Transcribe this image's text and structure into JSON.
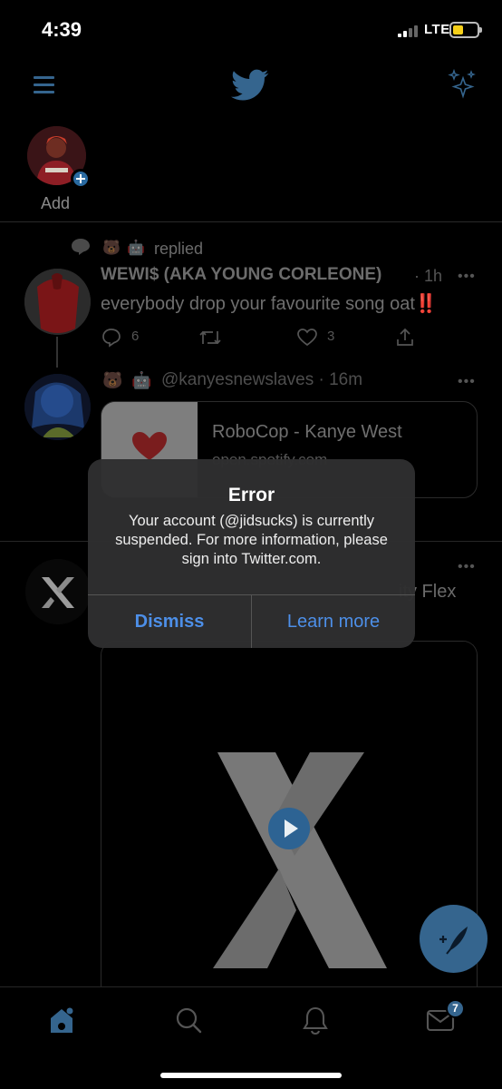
{
  "status_bar": {
    "time": "4:39",
    "network": "LTE",
    "colors": {
      "battery": "#f6d019"
    }
  },
  "header": {
    "menu_icon": "hamburger-icon",
    "logo_icon": "twitter-bird-icon",
    "sparkle_icon": "sparkle-icon"
  },
  "fleets": {
    "add_label": "Add"
  },
  "timeline": {
    "context": {
      "icon": "reply-bubble-icon",
      "emojis": [
        "🐻",
        "🤖"
      ],
      "text": "replied"
    },
    "tweet1": {
      "name": "WEWI$ (AKA YOUNG CORLEONE)",
      "time": "· 1h",
      "more": "•••",
      "body": "everybody drop your favourite song oat",
      "body_emoji": "‼️",
      "replies": "6",
      "likes": "3"
    },
    "tweet2": {
      "emojis": [
        "🐻",
        "🤖"
      ],
      "handle": "@kanyesnewslaves",
      "time": "· 16m",
      "more": "•••",
      "card_title": "RoboCop - Kanye West",
      "card_domain": "open.spotify.com"
    },
    "tweet3": {
      "partial_text": "ity Flex",
      "more": "•••"
    }
  },
  "modal": {
    "title": "Error",
    "message": "Your account (@jidsucks) is currently suspended. For more information, please sign into Twitter.com.",
    "dismiss_label": "Dismiss",
    "learn_more_label": "Learn more"
  },
  "tab_bar": {
    "items": [
      "home-icon",
      "search-icon",
      "notifications-icon",
      "messages-icon"
    ],
    "messages_badge": "7"
  },
  "colors": {
    "accent": "#35658e",
    "alert_button": "#4d8fe8",
    "background": "#000000"
  }
}
